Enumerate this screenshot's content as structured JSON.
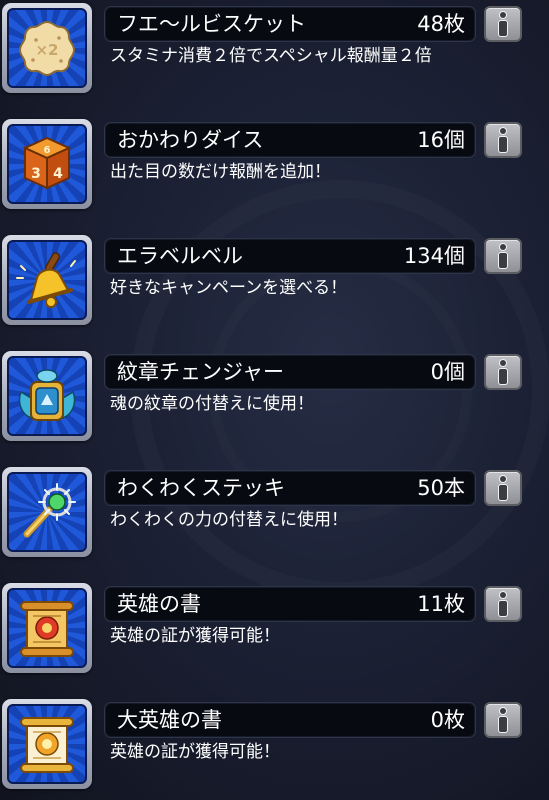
{
  "items": [
    {
      "name": "フエ〜ルビスケット",
      "count": "48枚",
      "description": "スタミナ消費２倍でスペシャル報酬量２倍",
      "icon": "biscuit-icon"
    },
    {
      "name": "おかわりダイス",
      "count": "16個",
      "description": "出た目の数だけ報酬を追加！",
      "icon": "dice-icon"
    },
    {
      "name": "エラベルベル",
      "count": "134個",
      "description": "好きなキャンペーンを選べる！",
      "icon": "bell-icon"
    },
    {
      "name": "紋章チェンジャー",
      "count": "0個",
      "description": "魂の紋章の付替えに使用！",
      "icon": "emblem-changer-icon"
    },
    {
      "name": "わくわくステッキ",
      "count": "50本",
      "description": "わくわくの力の付替えに使用！",
      "icon": "wand-icon"
    },
    {
      "name": "英雄の書",
      "count": "11枚",
      "description": "英雄の証が獲得可能！",
      "icon": "hero-scroll-icon"
    },
    {
      "name": "大英雄の書",
      "count": "0枚",
      "description": "英雄の証が獲得可能！",
      "icon": "great-hero-scroll-icon"
    }
  ],
  "dice_faces": [
    "6",
    "3",
    "4"
  ],
  "biscuit_mark": "×2"
}
